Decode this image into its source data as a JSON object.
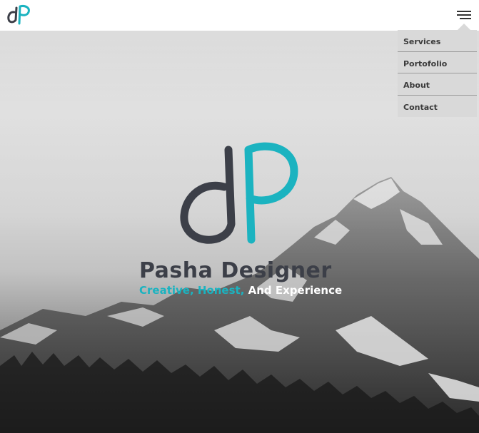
{
  "header": {
    "logo_alt": "dP",
    "menu_icon": "hamburger-menu-icon"
  },
  "nav": {
    "items": [
      {
        "label": "Services"
      },
      {
        "label": "Portofolio"
      },
      {
        "label": "About"
      },
      {
        "label": "Contact"
      }
    ]
  },
  "hero": {
    "title": "Pasha Designer",
    "tagline_accent": "Creative, Honest,",
    "tagline_rest": " And Experience"
  },
  "colors": {
    "brand_teal": "#1bb3c0",
    "brand_dark": "#3c3f48",
    "menu_bg": "#d9d9d9"
  }
}
